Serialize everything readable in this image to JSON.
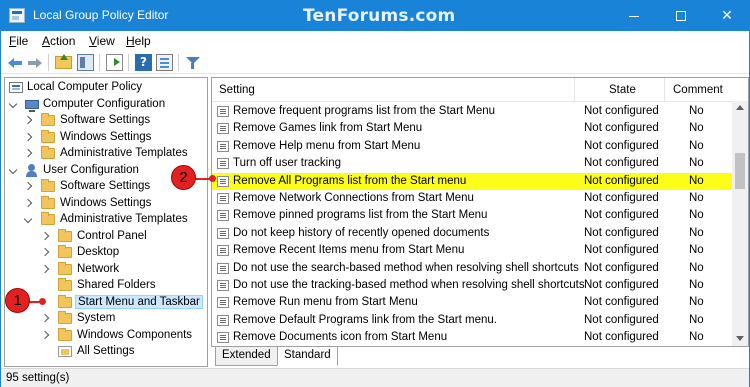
{
  "window": {
    "title": "Local Group Policy Editor",
    "watermark": "TenForums.com",
    "accent_color": "#1883d7",
    "controls": [
      "minimize-icon",
      "maximize-icon",
      "close-icon"
    ]
  },
  "menu": {
    "file": {
      "u": "F",
      "rest": "ile"
    },
    "action": {
      "u": "A",
      "rest": "ction"
    },
    "view": {
      "u": "V",
      "rest": "iew"
    },
    "help": {
      "u": "H",
      "rest": "elp"
    }
  },
  "toolbar": {
    "icons": [
      "back-arrow-icon",
      "forward-arrow-icon",
      "up-folder-icon",
      "show-hide-tree-icon",
      "export-list-icon",
      "help-icon",
      "properties-icon",
      "filter-icon"
    ],
    "help_glyph": "?"
  },
  "tree": {
    "root": "Local Computer Policy",
    "items": [
      {
        "label": "Local Computer Policy"
      },
      {
        "label": "Computer Configuration"
      },
      {
        "label": "Software Settings"
      },
      {
        "label": "Windows Settings"
      },
      {
        "label": "Administrative Templates"
      },
      {
        "label": "User Configuration"
      },
      {
        "label": "Software Settings"
      },
      {
        "label": "Windows Settings"
      },
      {
        "label": "Administrative Templates"
      },
      {
        "label": "Control Panel"
      },
      {
        "label": "Desktop"
      },
      {
        "label": "Network"
      },
      {
        "label": "Shared Folders"
      },
      {
        "label": "Start Menu and Taskbar"
      },
      {
        "label": "System"
      },
      {
        "label": "Windows Components"
      },
      {
        "label": "All Settings"
      }
    ],
    "selected": "Start Menu and Taskbar"
  },
  "list": {
    "columns": {
      "setting": "Setting",
      "state": "State",
      "comment": "Comment"
    },
    "rows": [
      {
        "setting": "Remove frequent programs list from the Start Menu",
        "state": "Not configured",
        "comment": "No"
      },
      {
        "setting": "Remove Games link from Start Menu",
        "state": "Not configured",
        "comment": "No"
      },
      {
        "setting": "Remove Help menu from Start Menu",
        "state": "Not configured",
        "comment": "No"
      },
      {
        "setting": "Turn off user tracking",
        "state": "Not configured",
        "comment": "No"
      },
      {
        "setting": "Remove All Programs list from the Start menu",
        "state": "Not configured",
        "comment": "No"
      },
      {
        "setting": "Remove Network Connections from Start Menu",
        "state": "Not configured",
        "comment": "No"
      },
      {
        "setting": "Remove pinned programs list from the Start Menu",
        "state": "Not configured",
        "comment": "No"
      },
      {
        "setting": "Do not keep history of recently opened documents",
        "state": "Not configured",
        "comment": "No"
      },
      {
        "setting": "Remove Recent Items menu from Start Menu",
        "state": "Not configured",
        "comment": "No"
      },
      {
        "setting": "Do not use the search-based method when resolving shell shortcuts",
        "state": "Not configured",
        "comment": "No"
      },
      {
        "setting": "Do not use the tracking-based method when resolving shell shortcuts",
        "state": "Not configured",
        "comment": "No"
      },
      {
        "setting": "Remove Run menu from Start Menu",
        "state": "Not configured",
        "comment": "No"
      },
      {
        "setting": "Remove Default Programs link from the Start menu.",
        "state": "Not configured",
        "comment": "No"
      },
      {
        "setting": "Remove Documents icon from Start Menu",
        "state": "Not configured",
        "comment": "No"
      }
    ],
    "highlighted": "Remove All Programs list from the Start menu",
    "highlight_color": "#fdfd1a"
  },
  "tabs": {
    "extended": "Extended",
    "standard": "Standard"
  },
  "status": {
    "text": "95 setting(s)"
  },
  "callouts": {
    "one": "1",
    "two": "2",
    "color": "#e22222"
  }
}
